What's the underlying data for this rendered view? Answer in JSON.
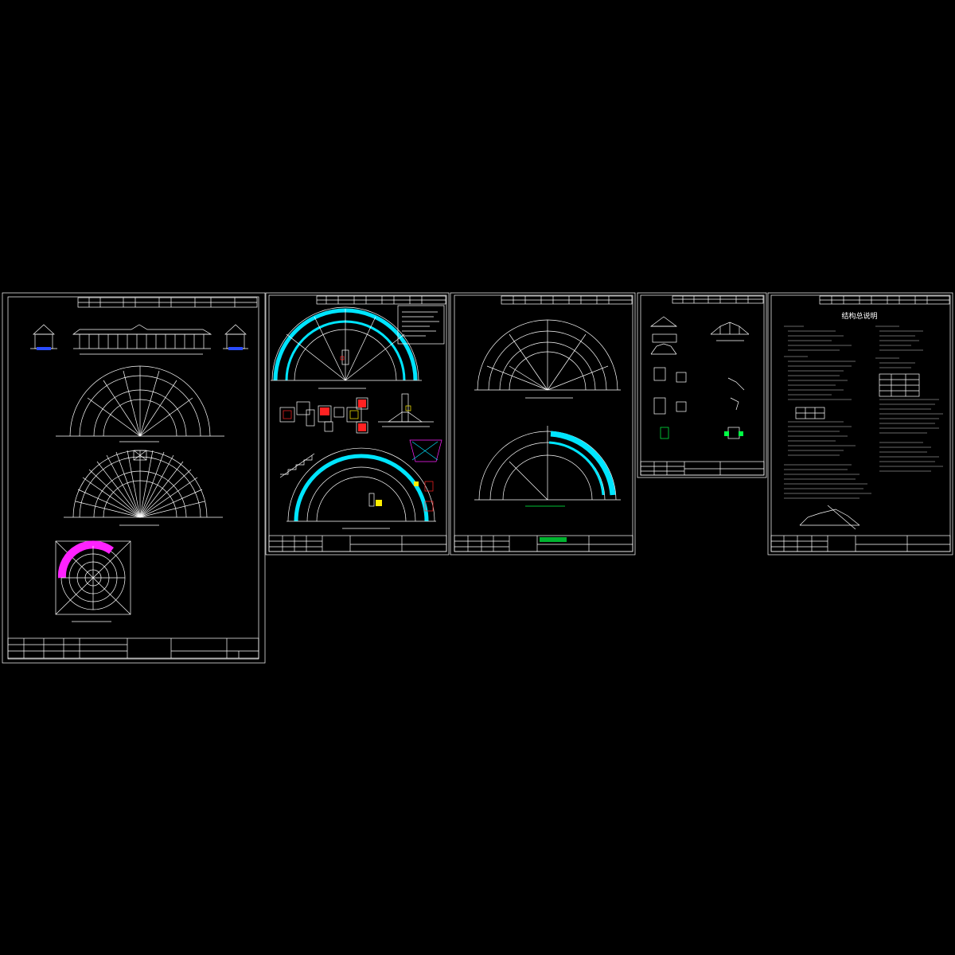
{
  "app": {
    "background": "#000000"
  },
  "colors": {
    "line": "#ffffff",
    "accent_cyan": "#00e5ff",
    "accent_magenta": "#ff22ff",
    "accent_red": "#ff2222",
    "accent_yellow": "#ffee00",
    "accent_green": "#00ff44"
  },
  "sheets": [
    {
      "id": "sheet-1",
      "kind": "elevations-and-plans"
    },
    {
      "id": "sheet-2",
      "kind": "foundation-plan-and-details"
    },
    {
      "id": "sheet-3",
      "kind": "layout-plans"
    },
    {
      "id": "sheet-4",
      "kind": "node-details"
    },
    {
      "id": "sheet-5",
      "kind": "structural-notes",
      "title": "结构总说明"
    }
  ]
}
